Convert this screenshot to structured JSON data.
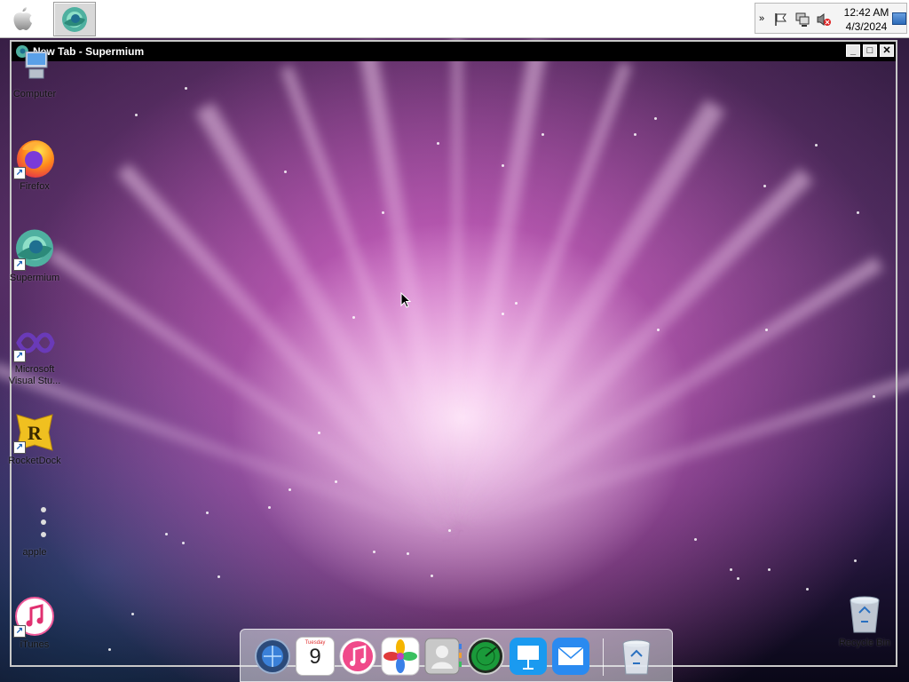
{
  "taskbar": {
    "apple_icon": "apple-logo-icon",
    "active_task_icon": "supermium-icon",
    "tray": {
      "time": "12:42 AM",
      "date": "4/3/2024"
    }
  },
  "window": {
    "title": "New Tab - Supermium",
    "minimize": "_",
    "maximize": "□",
    "close": "✕"
  },
  "desktop_icons": [
    {
      "label": "Computer",
      "icon": "computer-icon"
    },
    {
      "label": "Firefox",
      "icon": "firefox-icon"
    },
    {
      "label": "Supermium",
      "icon": "supermium-icon"
    },
    {
      "label": "Microsoft Visual Stu...",
      "icon": "visual-studio-icon"
    },
    {
      "label": "RocketDock",
      "icon": "rocketdock-icon"
    },
    {
      "label": "apple",
      "icon": "apple-dots-icon"
    },
    {
      "label": "iTunes",
      "icon": "itunes-icon"
    },
    {
      "label": "Recycle Bin",
      "icon": "recycle-bin-icon"
    }
  ],
  "dock": {
    "calendar_day_name": "Tuesday",
    "calendar_day": "9",
    "items": [
      "globe-icon",
      "calendar-icon",
      "music-icon",
      "photos-icon",
      "contacts-icon",
      "radar-icon",
      "keynote-icon",
      "mail-icon",
      "trash-icon"
    ]
  },
  "colors": {
    "title_bar": "#000000",
    "wallpaper_pink": "#e070d0"
  }
}
